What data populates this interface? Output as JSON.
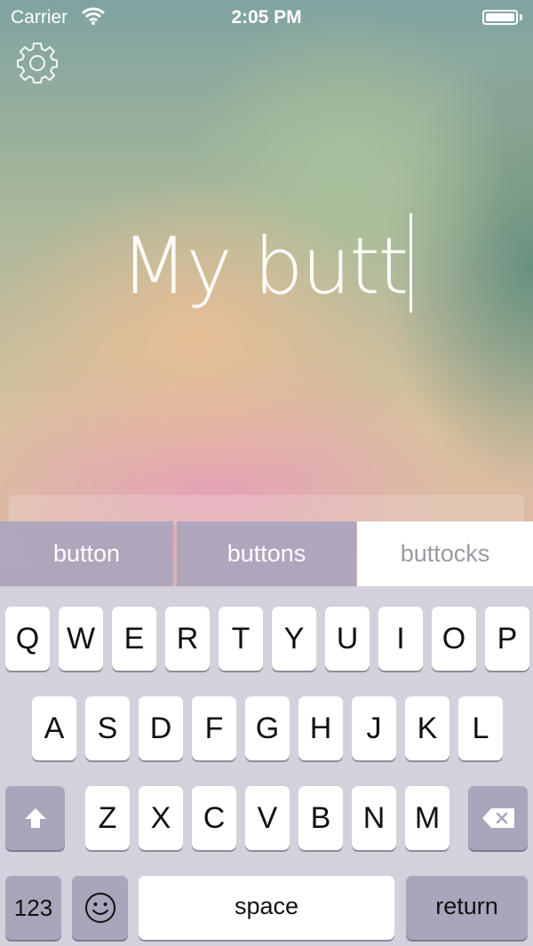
{
  "status": {
    "carrier": "Carrier",
    "time": "2:05 PM"
  },
  "icons": {
    "settings": "gear-icon",
    "wifi": "wifi-icon",
    "battery": "battery-icon",
    "shift": "shift-icon",
    "backspace": "backspace-icon",
    "emoji": "emoji-icon"
  },
  "editor": {
    "text": "My butt"
  },
  "suggestions": [
    "button",
    "buttons",
    "buttocks"
  ],
  "keyboard": {
    "row1": [
      "Q",
      "W",
      "E",
      "R",
      "T",
      "Y",
      "U",
      "I",
      "O",
      "P"
    ],
    "row2": [
      "A",
      "S",
      "D",
      "F",
      "G",
      "H",
      "J",
      "K",
      "L"
    ],
    "row3": [
      "Z",
      "X",
      "C",
      "V",
      "B",
      "N",
      "M"
    ],
    "numbers_label": "123",
    "space_label": "space",
    "return_label": "return"
  },
  "colors": {
    "keyboard_bg": "#d4d0dc",
    "key_bg": "#ffffff",
    "dark_key_bg": "#aaa5bb",
    "suggestion_bg": "#aaa5be",
    "suggestion_selected_bg": "#ffffff"
  }
}
